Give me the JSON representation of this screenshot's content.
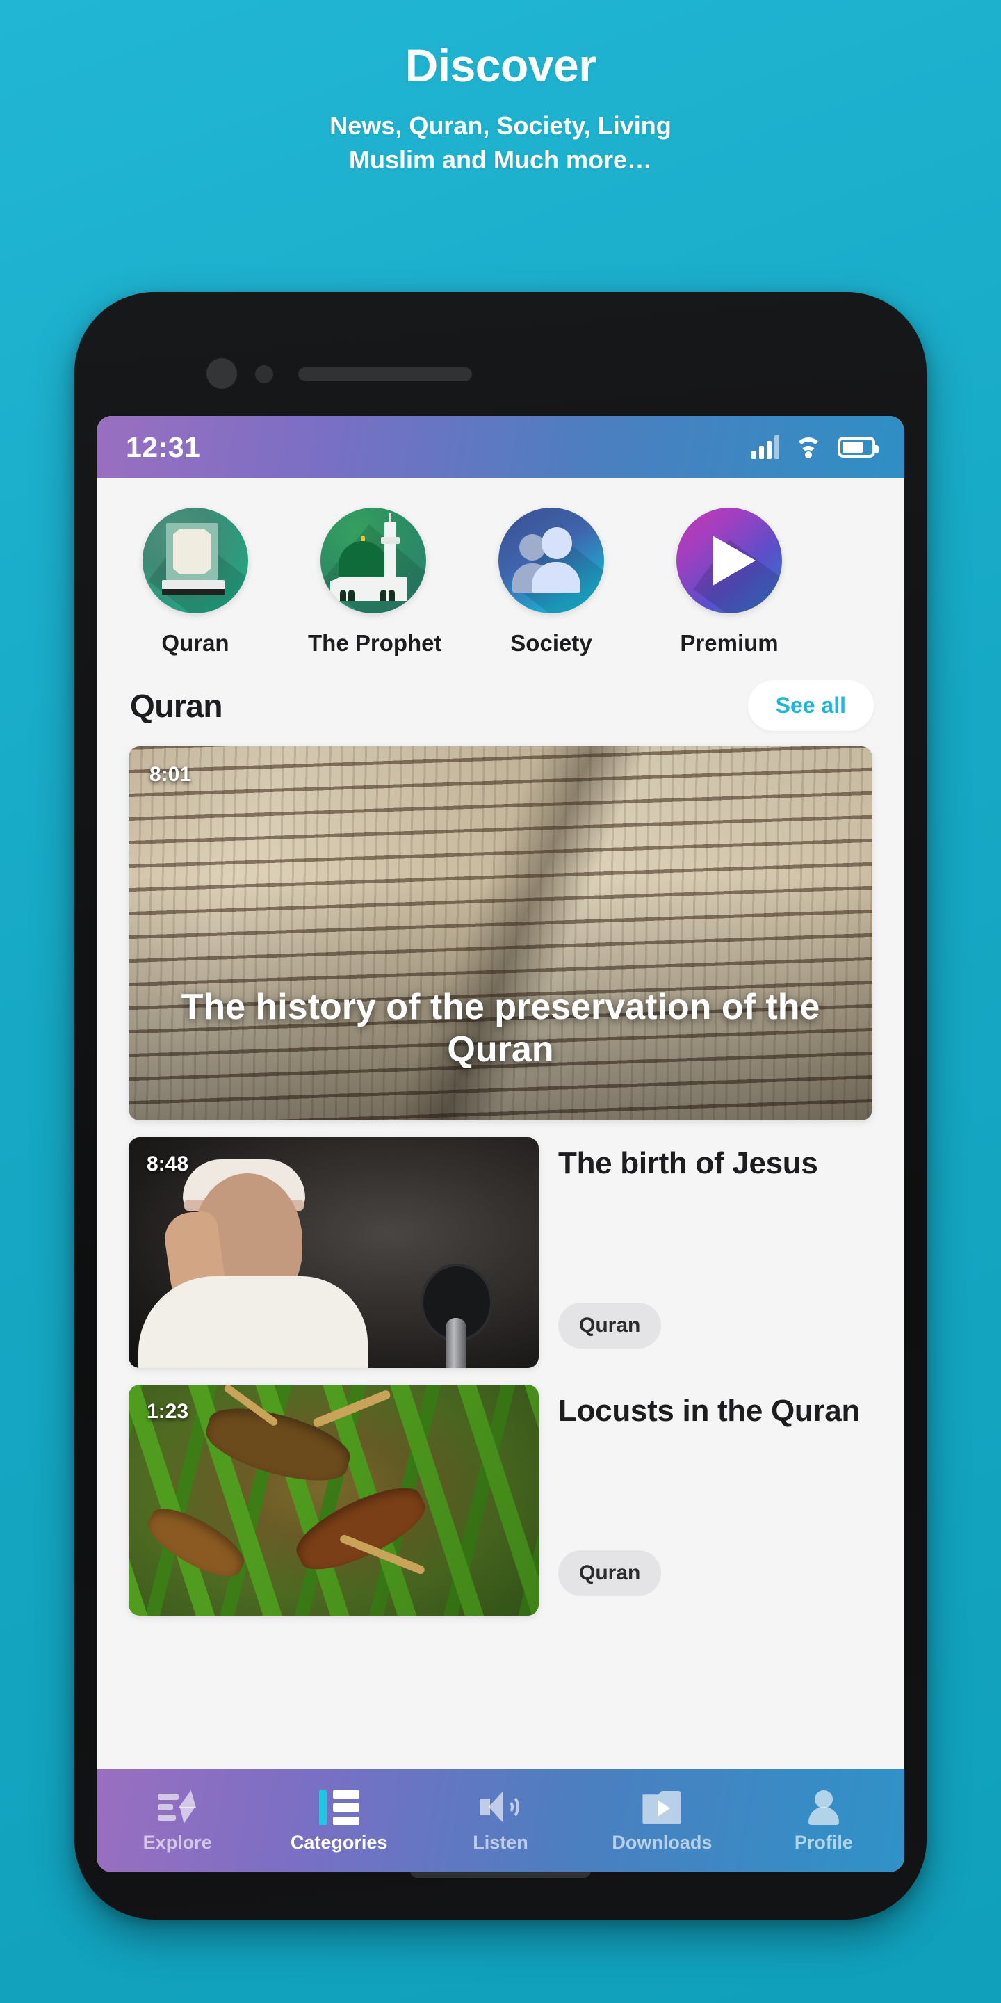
{
  "promo": {
    "title": "Discover",
    "subtitle_line1": "News, Quran, Society, Living",
    "subtitle_line2": "Muslim and Much more…"
  },
  "theme": {
    "background": "#16a8c4",
    "accent": "#21b6d4",
    "tabbar_gradient_start": "#9a6fc0",
    "tabbar_gradient_end": "#2f92c8",
    "screen_background": "#f5f5f5"
  },
  "statusbar": {
    "time": "12:31",
    "icons": [
      "signal-icon",
      "wifi-icon",
      "battery-icon"
    ]
  },
  "categories": [
    {
      "label": "Quran",
      "icon": "quran-book-icon"
    },
    {
      "label": "The Prophet",
      "icon": "mosque-icon"
    },
    {
      "label": "Society",
      "icon": "people-icon"
    },
    {
      "label": "Premium",
      "icon": "play-circle-icon"
    }
  ],
  "section": {
    "title": "Quran",
    "see_all_label": "See all"
  },
  "hero": {
    "duration": "8:01",
    "title": "The history of the preservation of the Quran"
  },
  "items": [
    {
      "duration": "8:48",
      "title": "The birth of Jesus",
      "tag": "Quran"
    },
    {
      "duration": "1:23",
      "title": "Locusts in the Quran",
      "tag": "Quran"
    }
  ],
  "tabbar": [
    {
      "label": "Explore",
      "icon": "explore-icon",
      "active": false
    },
    {
      "label": "Categories",
      "icon": "categories-icon",
      "active": true
    },
    {
      "label": "Listen",
      "icon": "speaker-icon",
      "active": false
    },
    {
      "label": "Downloads",
      "icon": "downloads-icon",
      "active": false
    },
    {
      "label": "Profile",
      "icon": "profile-icon",
      "active": false
    }
  ]
}
